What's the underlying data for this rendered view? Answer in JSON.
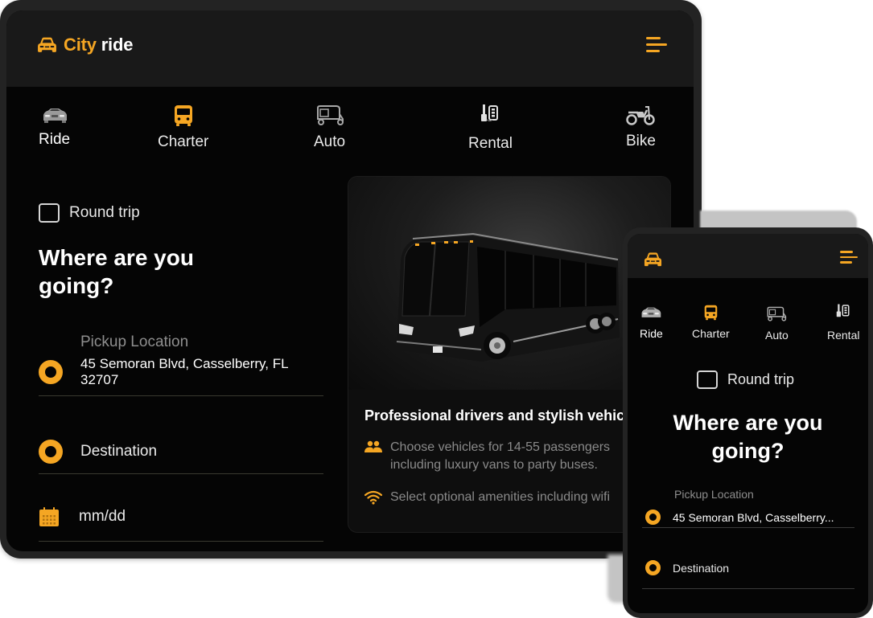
{
  "app": {
    "brand_first": "City",
    "brand_second": "ride",
    "logo_icon": "car-front-icon",
    "menu_icon": "hamburger-menu-icon",
    "accent_color": "#f5a623"
  },
  "tabs": [
    {
      "label": "Ride",
      "icon": "sedan-car-icon",
      "active": true
    },
    {
      "label": "Charter",
      "icon": "bus-icon",
      "active": false
    },
    {
      "label": "Auto",
      "icon": "auto-rickshaw-icon",
      "active": false
    },
    {
      "label": "Rental",
      "icon": "car-key-icon",
      "active": false
    },
    {
      "label": "Bike",
      "icon": "motorcycle-icon",
      "active": false
    }
  ],
  "form": {
    "round_trip_label": "Round trip",
    "round_trip_checked": false,
    "title": "Where are you going?",
    "pickup_label": "Pickup Location",
    "pickup_value": "45 Semoran Blvd, Casselberry, FL 32707",
    "pickup_value_truncated": "45 Semoran Blvd, Casselberry...",
    "destination_placeholder": "Destination",
    "date_placeholder": "mm/dd"
  },
  "promo_card": {
    "image_alt": "Black charter coach bus",
    "title": "Professional drivers and stylish vehicles",
    "features": [
      {
        "icon": "people-group-icon",
        "text": "Choose vehicles for 14-55 passengers including luxury vans to party buses."
      },
      {
        "icon": "wifi-icon",
        "text": "Select optional amenities including wifi"
      }
    ]
  }
}
